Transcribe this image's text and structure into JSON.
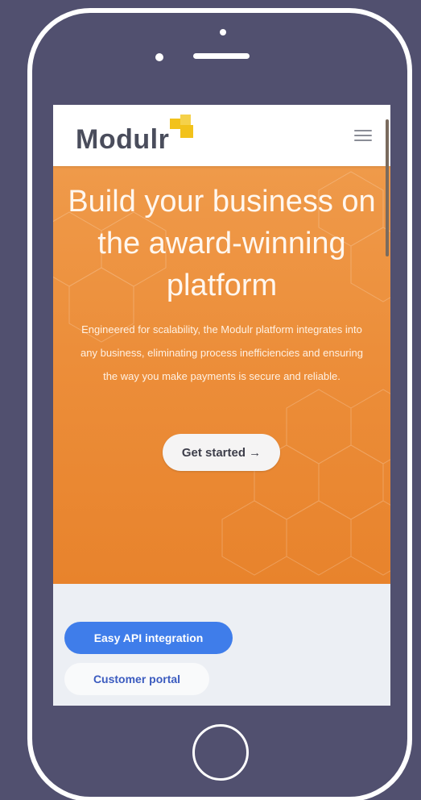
{
  "colors": {
    "background": "#51506f",
    "hero_orange": "#ec8e3a",
    "accent_blue": "#3f7dea",
    "logo_yellow": "#f2c21b"
  },
  "header": {
    "logo_text": "Modulr",
    "menu_icon": "hamburger-menu-icon"
  },
  "hero": {
    "title": "Build your business on the award-winning platform",
    "description": "Engineered for scalability, the Modulr platform integrates into any business, eliminating process inefficiencies and ensuring the way you make payments is secure and reliable.",
    "cta_label": "Get started →"
  },
  "features": {
    "tabs": [
      {
        "label": "Easy API integration",
        "active": true
      },
      {
        "label": "Customer portal",
        "active": false
      }
    ]
  }
}
